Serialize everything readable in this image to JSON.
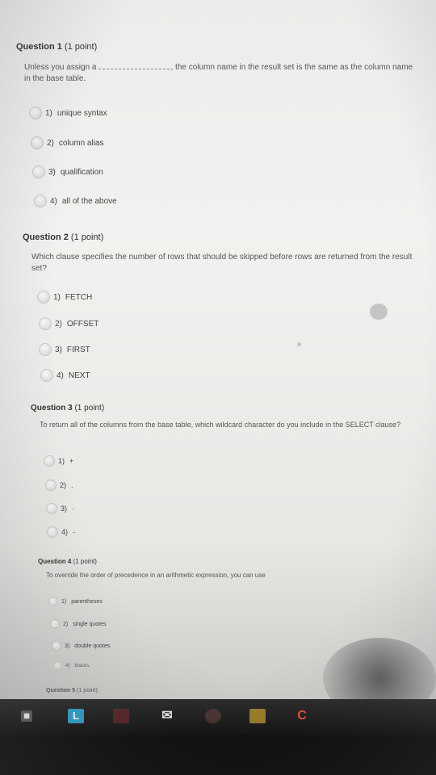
{
  "questions": [
    {
      "title": "Question 1",
      "points": "(1 point)",
      "text_before": "Unless you assign a",
      "text_after": ", the column name in the result set is the same as the column name in the base table.",
      "options": [
        {
          "num": "1)",
          "label": "unique syntax"
        },
        {
          "num": "2)",
          "label": "column alias"
        },
        {
          "num": "3)",
          "label": "qualification"
        },
        {
          "num": "4)",
          "label": "all of the above"
        }
      ]
    },
    {
      "title": "Question 2",
      "points": "(1 point)",
      "text": "Which clause specifies the number of rows that should be skipped before rows are returned from the result set?",
      "options": [
        {
          "num": "1)",
          "label": "FETCH"
        },
        {
          "num": "2)",
          "label": "OFFSET"
        },
        {
          "num": "3)",
          "label": "FIRST"
        },
        {
          "num": "4)",
          "label": "NEXT"
        }
      ]
    },
    {
      "title": "Question 3",
      "points": "(1 point)",
      "text": "To return all of the columns from the base table, which wildcard character do you include in the SELECT clause?",
      "options": [
        {
          "num": "1)",
          "label": "+"
        },
        {
          "num": "2)",
          "label": "."
        },
        {
          "num": "3)",
          "label": "·"
        },
        {
          "num": "4)",
          "label": "-"
        }
      ]
    },
    {
      "title": "Question 4",
      "points": "(1 point)",
      "text": "To override the order of precedence in an arithmetic expression, you can use",
      "options": [
        {
          "num": "1)",
          "label": "parentheses"
        },
        {
          "num": "2)",
          "label": "single quotes"
        },
        {
          "num": "3)",
          "label": "double quotes"
        },
        {
          "num": "4)",
          "label": "braces"
        }
      ]
    },
    {
      "title": "Question 5",
      "points": "(1 point)"
    }
  ],
  "taskbar": {
    "app_l": "L",
    "app_c": "C"
  }
}
